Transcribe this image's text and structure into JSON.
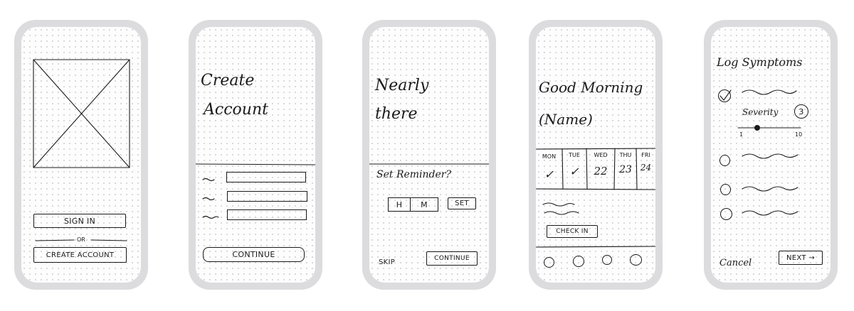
{
  "screens": [
    {
      "id": "welcome",
      "sign_in": "SIGN IN",
      "or": "OR",
      "create_account": "CREATE ACCOUNT"
    },
    {
      "id": "create-account",
      "title_line1": "Create",
      "title_line2": "Account",
      "continue": "CONTINUE"
    },
    {
      "id": "reminder",
      "title_line1": "Nearly",
      "title_line2": "there",
      "set_reminder": "Set Reminder?",
      "hours": "H",
      "minutes": "M",
      "set": "SET",
      "skip": "SKIP",
      "continue": "CONTINUE"
    },
    {
      "id": "home",
      "greeting_line1": "Good Morning",
      "greeting_line2": "(Name)",
      "days": [
        {
          "label": "MON",
          "mark": "✓"
        },
        {
          "label": "TUE",
          "mark": "✓"
        },
        {
          "label": "WED",
          "mark": "22"
        },
        {
          "label": "THU",
          "mark": "23"
        },
        {
          "label": "FRI",
          "mark": "24"
        }
      ],
      "check_in": "CHECK IN"
    },
    {
      "id": "log-symptoms",
      "title": "Log Symptoms",
      "severity_label": "Severity",
      "severity_value": "3",
      "slider_min": "1",
      "slider_max": "10",
      "slider_value": 0.25,
      "cancel": "Cancel",
      "next": "NEXT →"
    }
  ]
}
